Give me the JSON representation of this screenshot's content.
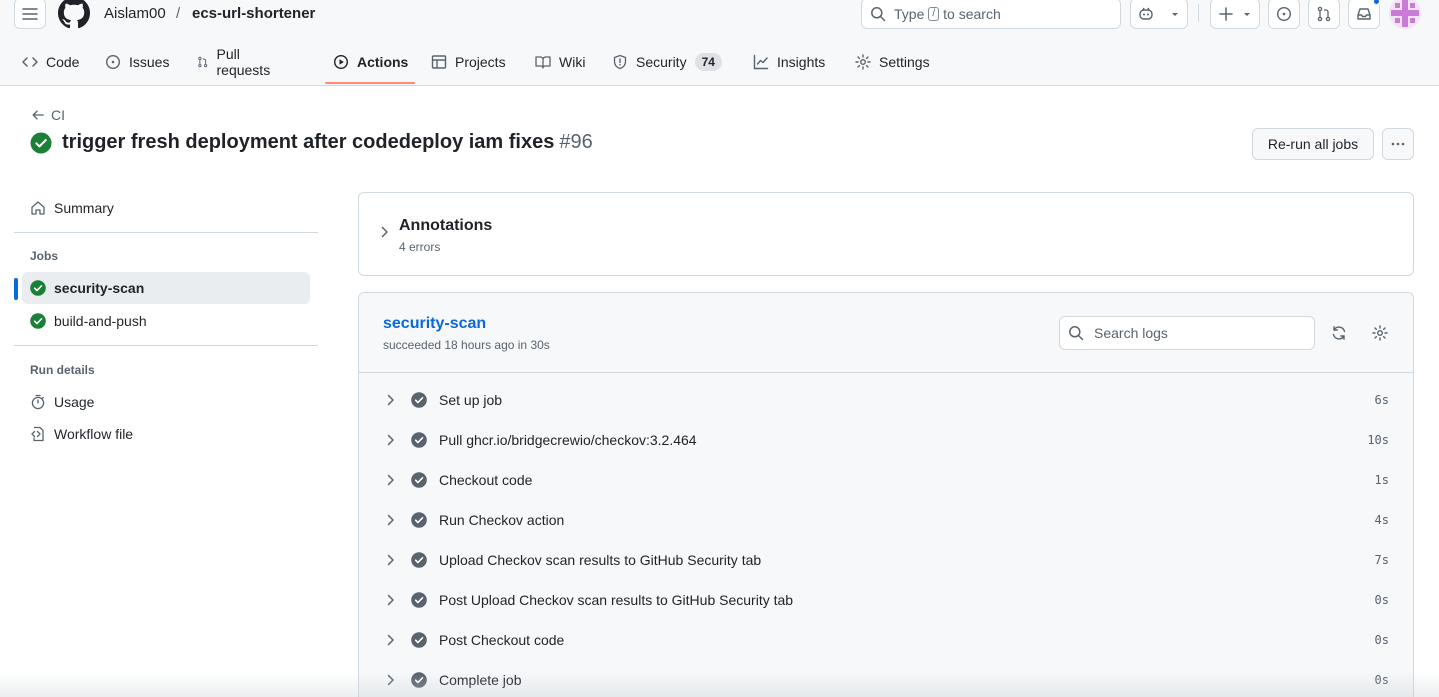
{
  "header": {
    "owner": "Aislam00",
    "separator": "/",
    "repo": "ecs-url-shortener",
    "search": {
      "prefix": "Type",
      "key": "/",
      "suffix": "to search"
    }
  },
  "tabs": [
    {
      "label": "Code",
      "icon": "code-icon"
    },
    {
      "label": "Issues",
      "icon": "issue-icon"
    },
    {
      "label": "Pull requests",
      "icon": "pull-request-icon"
    },
    {
      "label": "Actions",
      "icon": "play-icon",
      "active": true
    },
    {
      "label": "Projects",
      "icon": "table-icon"
    },
    {
      "label": "Wiki",
      "icon": "book-icon"
    },
    {
      "label": "Security",
      "icon": "shield-icon",
      "count": "74"
    },
    {
      "label": "Insights",
      "icon": "graph-icon"
    },
    {
      "label": "Settings",
      "icon": "gear-icon"
    }
  ],
  "run": {
    "back_label": "CI",
    "title": "trigger fresh deployment after codedeploy iam fixes",
    "number": "#96",
    "rerun_label": "Re-run all jobs",
    "status": "success"
  },
  "sidebar": {
    "summary_label": "Summary",
    "jobs_heading": "Jobs",
    "jobs": [
      {
        "label": "security-scan",
        "selected": true
      },
      {
        "label": "build-and-push",
        "selected": false
      }
    ],
    "run_details_heading": "Run details",
    "details": [
      {
        "label": "Usage",
        "icon": "stopwatch-icon"
      },
      {
        "label": "Workflow file",
        "icon": "file-code-icon"
      }
    ]
  },
  "annotations": {
    "title": "Annotations",
    "subtitle": "4 errors"
  },
  "job": {
    "name": "security-scan",
    "meta": "succeeded 18 hours ago in 30s",
    "search_placeholder": "Search logs",
    "steps": [
      {
        "name": "Set up job",
        "time": "6s"
      },
      {
        "name": "Pull ghcr.io/bridgecrewio/checkov:3.2.464",
        "time": "10s"
      },
      {
        "name": "Checkout code",
        "time": "1s"
      },
      {
        "name": "Run Checkov action",
        "time": "4s"
      },
      {
        "name": "Upload Checkov scan results to GitHub Security tab",
        "time": "7s"
      },
      {
        "name": "Post Upload Checkov scan results to GitHub Security tab",
        "time": "0s"
      },
      {
        "name": "Post Checkout code",
        "time": "0s"
      },
      {
        "name": "Complete job",
        "time": "0s"
      }
    ]
  },
  "colors": {
    "success": "#1a7f37",
    "step_check": "#59636e",
    "link": "#0969da",
    "active_tab_underline": "#fd8c73"
  }
}
